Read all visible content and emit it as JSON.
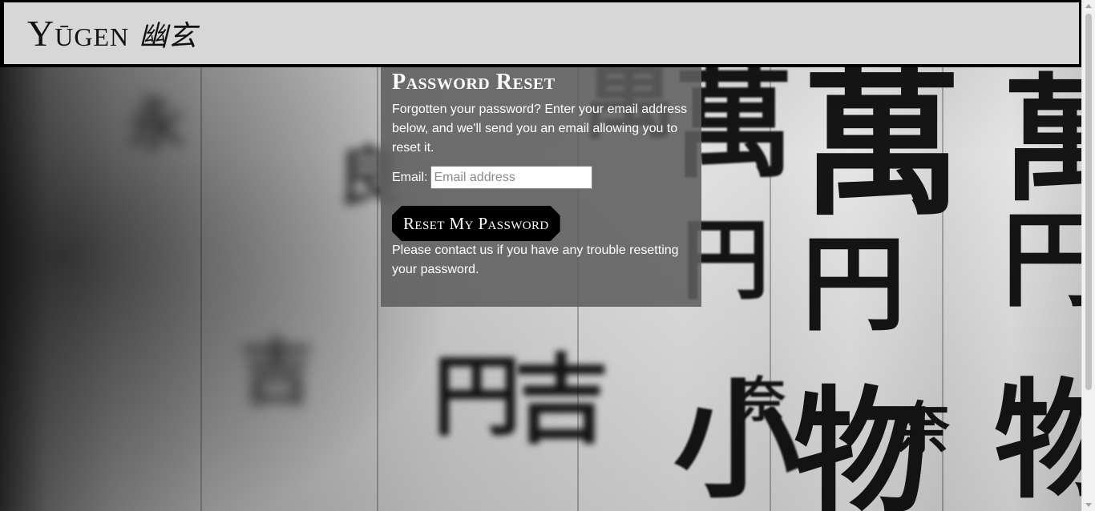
{
  "header": {
    "brand_latin": "Yūgen",
    "brand_kanji": "幽玄"
  },
  "reset": {
    "title": "Password Reset",
    "intro": "Forgotten your password? Enter your email address below, and we'll send you an email allowing you to reset it.",
    "email_label": "Email:",
    "email_placeholder": "Email address",
    "email_value": "",
    "button_label": "Reset My Password",
    "footer": "Please contact us if you have any trouble resetting your password."
  },
  "background": {
    "glyphs": [
      "萬",
      "円",
      "奈",
      "良",
      "小",
      "物",
      "吉",
      "永"
    ]
  },
  "colors": {
    "header_bg": "#d7d7d7",
    "header_border": "#000000",
    "card_bg": "#5f5f5f",
    "button_bg": "#000000",
    "text_light": "#ffffff"
  },
  "icons": {
    "scroll_up": "triangle-up-icon",
    "scroll_down": "triangle-down-icon"
  }
}
